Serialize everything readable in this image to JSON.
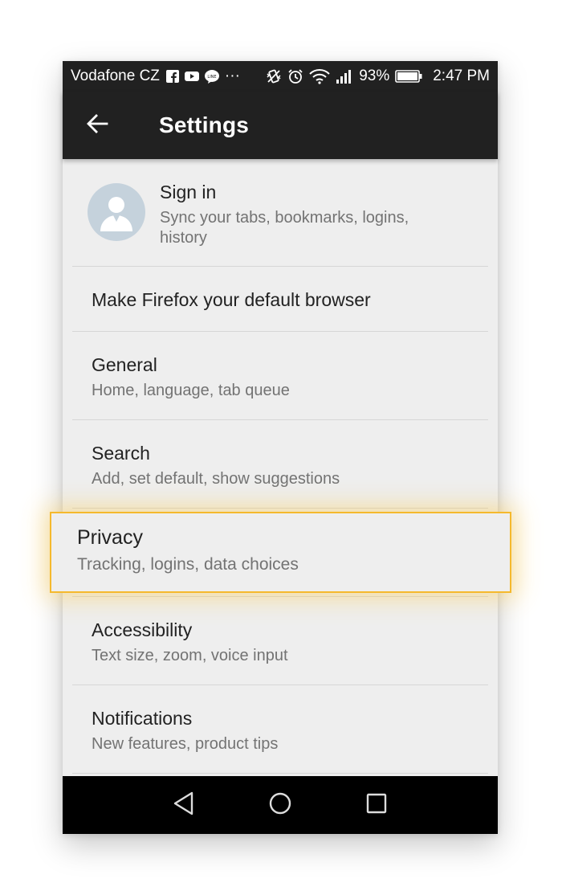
{
  "status_bar": {
    "carrier": "Vodafone CZ",
    "overflow": "···",
    "battery": "93%",
    "time": "2:47 PM",
    "icons": [
      "facebook-icon",
      "youtube-icon",
      "line-icon",
      "vibrate-icon",
      "alarm-icon",
      "wifi-icon",
      "signal-icon",
      "battery-icon"
    ]
  },
  "app_bar": {
    "back_icon": "arrow-left-icon",
    "title": "Settings"
  },
  "settings": {
    "sign_in": {
      "title": "Sign in",
      "subtitle": "Sync your tabs, bookmarks, logins, history",
      "icon": "avatar-icon"
    },
    "default_browser": {
      "title": "Make Firefox your default browser"
    },
    "general": {
      "title": "General",
      "subtitle": "Home, language, tab queue"
    },
    "search": {
      "title": "Search",
      "subtitle": "Add, set default, show suggestions"
    },
    "privacy": {
      "title": "Privacy",
      "subtitle": "Tracking, logins, data choices",
      "highlighted": true
    },
    "accessibility": {
      "title": "Accessibility",
      "subtitle": "Text size, zoom, voice input"
    },
    "notifications": {
      "title": "Notifications",
      "subtitle": "New features, product tips"
    }
  },
  "nav_bar": {
    "icons": [
      "back-triangle-icon",
      "home-circle-icon",
      "recents-square-icon"
    ]
  },
  "colors": {
    "bar": "#212121",
    "background": "#eeeeee",
    "highlight": "#f5b92d",
    "avatar": "#c5d2dc"
  }
}
